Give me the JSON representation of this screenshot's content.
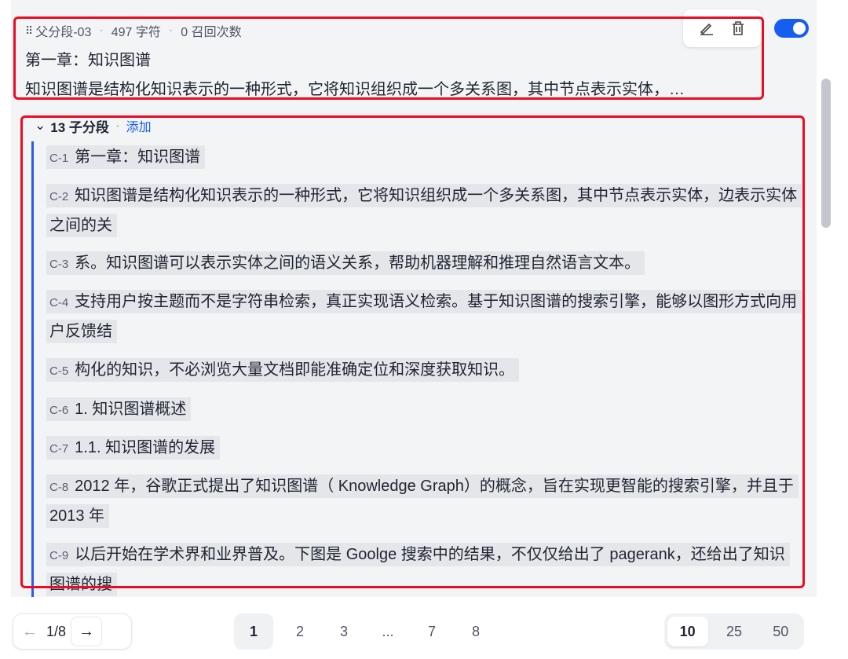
{
  "parent": {
    "segment_id": "父分段-03",
    "chars": "497 字符",
    "recalls": "0 召回次数",
    "title": "第一章：知识图谱",
    "text": "知识图谱是结构化知识表示的一种形式，它将知识组织成一个多关系图，其中节点表示实体，…"
  },
  "toolbar": {
    "edit_icon": "pencil-icon",
    "delete_icon": "trash-icon"
  },
  "children": {
    "header_count": "13 子分段",
    "add_label": "添加",
    "items": [
      {
        "tag": "C-1",
        "text": "第一章：知识图谱"
      },
      {
        "tag": "C-2",
        "text": "知识图谱是结构化知识表示的一种形式，它将知识组织成一个多关系图，其中节点表示实体，边表示实体之间的关"
      },
      {
        "tag": "C-3",
        "text": "系。知识图谱可以表示实体之间的语义关系，帮助机器理解和推理自然语言文本。"
      },
      {
        "tag": "C-4",
        "text": "支持用户按主题而不是字符串检索，真正实现语义检索。基于知识图谱的搜索引擎，能够以图形方式向用户反馈结"
      },
      {
        "tag": "C-5",
        "text": "构化的知识，不必浏览大量文档即能准确定位和深度获取知识。"
      },
      {
        "tag": "C-6",
        "text": "1. 知识图谱概述"
      },
      {
        "tag": "C-7",
        "text": "1.1. 知识图谱的发展"
      },
      {
        "tag": "C-8",
        "text": "2012 年，谷歌正式提出了知识图谱（ Knowledge Graph）的概念，旨在实现更智能的搜索引擎，并且于 2013 年"
      },
      {
        "tag": "C-9",
        "text": "以后开始在学术界和业界普及。下图是 Goolge 搜索中的结果，不仅仅给出了 pagerank，还给出了知识图谱的搜"
      }
    ]
  },
  "pagination": {
    "prev_icon": "arrow-left-icon",
    "next_icon": "arrow-right-icon",
    "position": "1/8",
    "pages": [
      "1",
      "2",
      "3",
      "...",
      "7",
      "8"
    ],
    "current_page": "1",
    "page_sizes": [
      "10",
      "25",
      "50"
    ],
    "current_size": "10"
  },
  "colors": {
    "accent": "#155eef",
    "highlight": "#e4e6ea",
    "annotation": "#ea0c23",
    "child_line": "#2e59e8"
  }
}
